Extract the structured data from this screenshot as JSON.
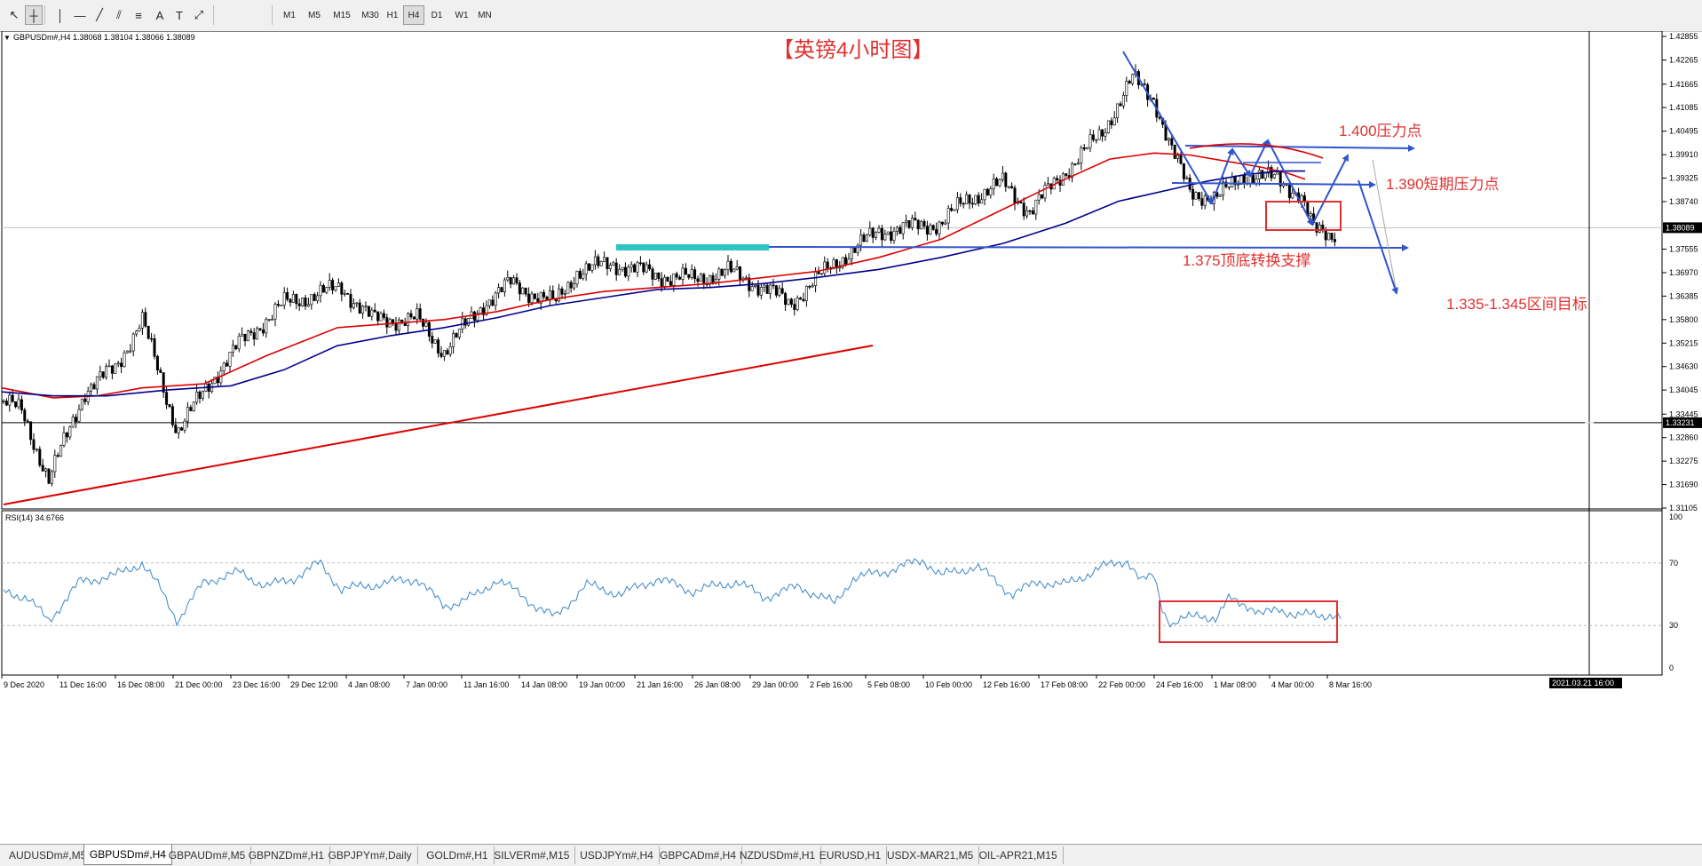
{
  "toolbar": {
    "tools": [
      {
        "icon": "cursor-arrow-icon",
        "glyph": "↖"
      },
      {
        "icon": "crosshair-icon",
        "glyph": "┼"
      },
      {
        "icon": "vertical-line-icon",
        "glyph": "│"
      },
      {
        "icon": "horizontal-line-icon",
        "glyph": "—"
      },
      {
        "icon": "trendline-icon",
        "glyph": "╱"
      },
      {
        "icon": "channel-icon",
        "glyph": "⫽"
      },
      {
        "icon": "fibonacci-icon",
        "glyph": "≡"
      },
      {
        "icon": "text-icon",
        "glyph": "A"
      },
      {
        "icon": "text-label-icon",
        "glyph": "T"
      },
      {
        "icon": "shapes-dropdown-icon",
        "glyph": "⤢"
      }
    ],
    "timeframes": [
      "M1",
      "M5",
      "M15",
      "M30",
      "H1",
      "H4",
      "D1",
      "W1",
      "MN"
    ],
    "active_timeframe": "H4"
  },
  "chart": {
    "info": "GBPUSDm#,H4  1.38068 1.38104 1.38066 1.38089",
    "title": "【英镑4小时图】",
    "annotations": {
      "pressure_1400": "1.400压力点",
      "pressure_1390": "1.390短期压力点",
      "support_1375": "1.375顶底转换支撑",
      "target": "1.335-1.345区间目标"
    },
    "price_ticks": [
      "1.42855",
      "1.42265",
      "1.41665",
      "1.41085",
      "1.40495",
      "1.39910",
      "1.39325",
      "1.38740",
      "1.38089",
      "1.37555",
      "1.36970",
      "1.36385",
      "1.35800",
      "1.35215",
      "1.34630",
      "1.34045",
      "1.33445",
      "1.33231",
      "1.32860",
      "1.32275",
      "1.31690",
      "1.31105"
    ],
    "current_price": "1.38089",
    "crosshair_price": "1.33231",
    "time_ticks": [
      "9 Dec 2020",
      "11 Dec 16:00",
      "16 Dec 08:00",
      "21 Dec 00:00",
      "23 Dec 16:00",
      "29 Dec 12:00",
      "4 Jan 08:00",
      "7 Jan 00:00",
      "11 Jan 16:00",
      "14 Jan 08:00",
      "19 Jan 00:00",
      "21 Jan 16:00",
      "26 Jan 08:00",
      "29 Jan 00:00",
      "2 Feb 16:00",
      "5 Feb 08:00",
      "10 Feb 00:00",
      "12 Feb 16:00",
      "17 Feb 08:00",
      "22 Feb 00:00",
      "24 Feb 16:00",
      "1 Mar 08:00",
      "4 Mar 00:00",
      "8 Mar 16:00"
    ],
    "crosshair_time": "2021.03.21 16:00",
    "colors": {
      "up": "#000000",
      "ma_fast": "#dd0000",
      "ma_slow": "#00008b",
      "arrows": "#3355cc",
      "annotation": "#e03030",
      "rsi": "#3a87c8",
      "resistance_box": "#2ec4c4"
    }
  },
  "rsi": {
    "label": "RSI(14) 34.6766",
    "ticks": [
      "100",
      "70",
      "30",
      "0"
    ]
  },
  "tabs": [
    "AUDUSDm#,M5",
    "GBPUSDm#,H4",
    "GBPAUDm#,M5",
    "GBPNZDm#,H1",
    "GBPJPYm#,Daily",
    "GOLDm#,H1",
    "SILVERm#,M15",
    "USDJPYm#,H4",
    "GBPCADm#,H4",
    "NZDUSDm#,H1",
    "EURUSD,H1",
    "USDX-MAR21,M5",
    "OIL-APR21,M15"
  ],
  "active_tab": "GBPUSDm#,H4"
}
